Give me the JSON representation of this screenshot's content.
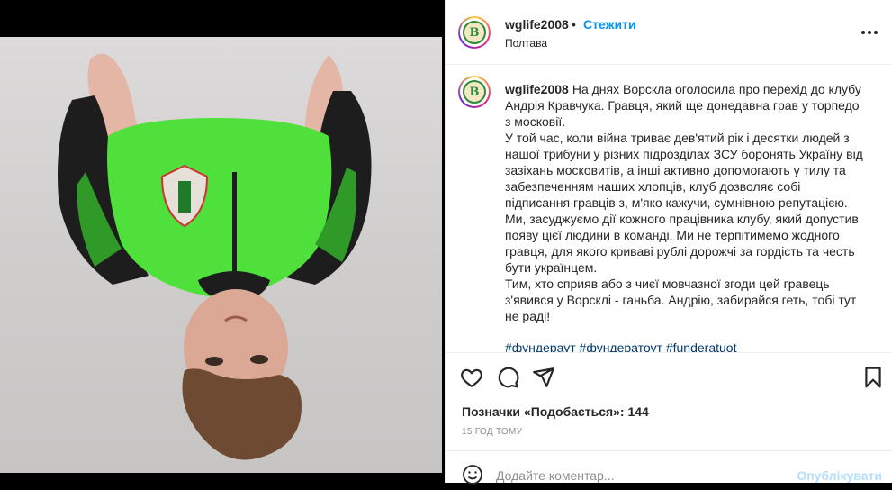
{
  "post": {
    "username": "wglife2008",
    "dot": "•",
    "follow_label": "Стежити",
    "location": "Полтава",
    "more_icon": "more-options-icon",
    "avatar_letter": "B"
  },
  "caption": {
    "username": "wglife2008",
    "text": "На днях Ворскла оголосила про перехід до клубу Андрія Кравчука. Гравця, який ще донедавна грав у торпедо з московії.\nУ той час, коли війна триває дев'ятий рік і десятки людей з нашої трибуни у різних підрозділах ЗСУ боронять Україну від зазіхань московитів, а інші активно допомогають у тилу та забезпеченням наших хлопців, клуб дозволяє собі підписання гравців з, м'яко кажучи, сумнівною репутацією.\nМи, засуджуємо дії кожного працівника клубу, який допустив появу цієї людини в команді. Ми не терпітимемо жодного гравця, для якого криваві рублі дорожчі за гордість та честь бути українцем.\nТим, хто сприяв або з чиєї мовчазної згоди цей гравець з'явився у Ворсклі - ганьба. Андрію, забирайся геть, тобі тут не раді!",
    "hashtags": "#фундераут #фундератоут #funderatuot"
  },
  "actions": {
    "like_icon": "heart-icon",
    "comment_icon": "comment-icon",
    "share_icon": "share-icon",
    "save_icon": "bookmark-icon"
  },
  "likes": {
    "label": "Позначки «Подобається»: 144"
  },
  "timestamp": "15 ГОД ТОМУ",
  "comment": {
    "emoji_icon": "emoji-icon",
    "placeholder": "Додайте коментар...",
    "publish_label": "Опублікувати"
  },
  "colors": {
    "accent": "#0095f6",
    "publish_disabled": "#b2dffc",
    "jersey_green": "#4fe03b"
  }
}
